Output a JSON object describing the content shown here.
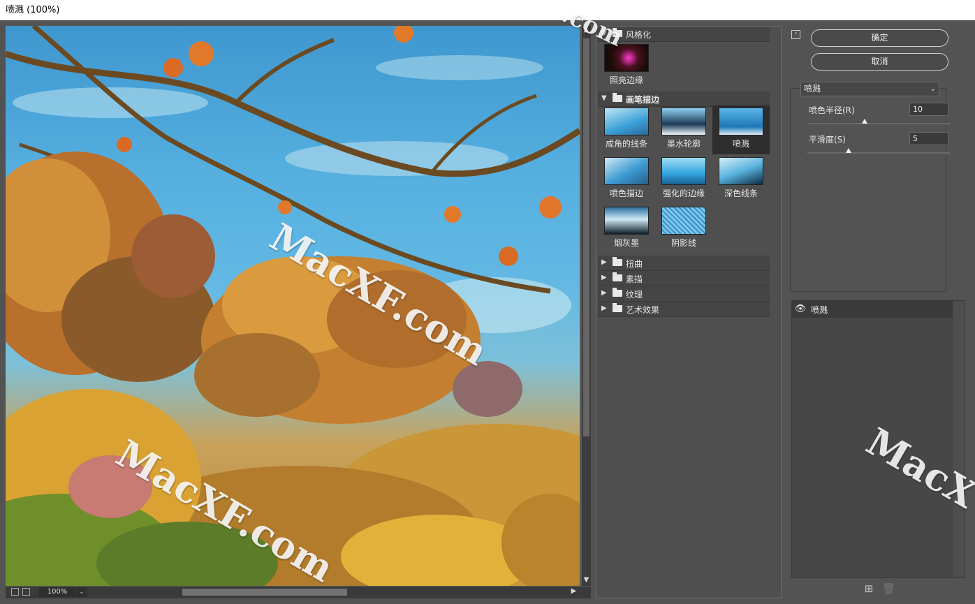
{
  "window": {
    "title": "喷溅 (100%)"
  },
  "preview": {
    "zoom": "100%",
    "watermarks": [
      "MacXF.com",
      "MacXF.com"
    ]
  },
  "gallery": {
    "categories": [
      {
        "name": "风格化",
        "expanded": true,
        "filters": [
          "照亮边缘"
        ]
      },
      {
        "name": "画笔描边",
        "expanded": true,
        "filters": [
          "成角的线条",
          "墨水轮廓",
          "喷溅",
          "喷色描边",
          "强化的边缘",
          "深色线条",
          "烟灰墨",
          "阴影线"
        ],
        "selected": "喷溅"
      },
      {
        "name": "扭曲",
        "expanded": false
      },
      {
        "name": "素描",
        "expanded": false
      },
      {
        "name": "纹理",
        "expanded": false
      },
      {
        "name": "艺术效果",
        "expanded": false
      }
    ]
  },
  "actions": {
    "ok": "确定",
    "cancel": "取消"
  },
  "settings": {
    "filter": "喷溅",
    "params": [
      {
        "label": "喷色半径(R)",
        "value": "10",
        "level": 0.4
      },
      {
        "label": "平滑度(S)",
        "value": "5",
        "level": 0.29
      }
    ]
  },
  "layers": {
    "items": [
      {
        "name": "喷溅",
        "visible": true
      }
    ]
  },
  "corner_watermark": "MacX",
  "top_watermark": ".com"
}
